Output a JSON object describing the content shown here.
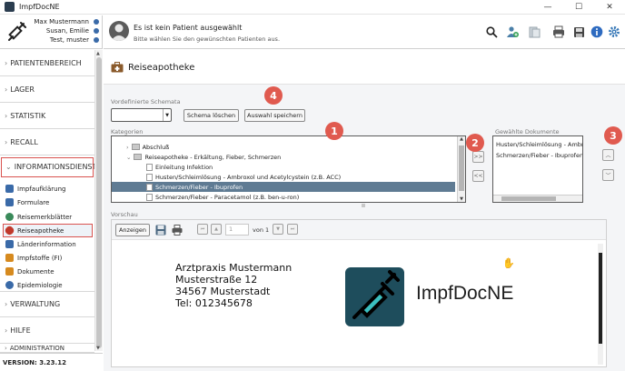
{
  "window": {
    "title": "ImpfDocNE",
    "minimize": "—",
    "maximize": "☐",
    "close": "✕"
  },
  "user": {
    "line1": "Max Mustermann",
    "line2": "Susan, Emilie",
    "line3": "Test, muster"
  },
  "patient": {
    "title": "Es ist kein Patient ausgewählt",
    "subtitle": "Bitte wählen Sie den gewünschten Patienten aus."
  },
  "toolbar_icons": [
    "search-icon",
    "add-patient-icon",
    "clipboard-icon",
    "print-icon",
    "disk-icon",
    "info-icon",
    "settings-icon"
  ],
  "sidebar": {
    "sections": [
      {
        "label": "PATIENTENBEREICH",
        "chevron": "›"
      },
      {
        "label": "LAGER",
        "chevron": "›"
      },
      {
        "label": "STATISTIK",
        "chevron": "›"
      },
      {
        "label": "RECALL",
        "chevron": "›"
      },
      {
        "label": "INFORMATIONSDIENST",
        "chevron": "⌄"
      }
    ],
    "items": [
      {
        "label": "Impfaufklärung",
        "color": "#3a6aa8"
      },
      {
        "label": "Formulare",
        "color": "#3a6aa8"
      },
      {
        "label": "Reisemerkblätter",
        "color": "#3a8a5a"
      },
      {
        "label": "Reiseapotheke",
        "color": "#c0392b"
      },
      {
        "label": "Länderinformation",
        "color": "#3a6aa8"
      },
      {
        "label": "Impfstoffe (FI)",
        "color": "#d68a1f"
      },
      {
        "label": "Dokumente",
        "color": "#d68a1f"
      },
      {
        "label": "Epidemiologie",
        "color": "#3a6aa8"
      }
    ],
    "bottom_sections": [
      {
        "label": "VERWALTUNG",
        "chevron": "›"
      },
      {
        "label": "HILFE",
        "chevron": "›"
      },
      {
        "label": "ADMINISTRATION",
        "chevron": "›"
      }
    ],
    "version": "VERSION: 3.23.12"
  },
  "page": {
    "title": "Reiseapotheke"
  },
  "schema": {
    "label": "Vordefinierte Schemata",
    "value": "",
    "delete_button": "Schema löschen",
    "save_button": "Auswahl speichern"
  },
  "categories": {
    "label": "Kategorien",
    "rows": [
      {
        "text": "Abschluß",
        "kind": "folder",
        "indent": 1,
        "toggle": "›"
      },
      {
        "text": "Reiseapotheke - Erkältung, Fieber, Schmerzen",
        "kind": "folder",
        "indent": 1,
        "toggle": "⌄"
      },
      {
        "text": "Einleitung Infektion",
        "kind": "doc",
        "indent": 2
      },
      {
        "text": "Husten/Schleimlösung - Ambroxol und Acetylcystein (z.B. ACC)",
        "kind": "doc",
        "indent": 2
      },
      {
        "text": "Schmerzen/Fieber - Ibuprofen",
        "kind": "doc",
        "indent": 2,
        "selected": true
      },
      {
        "text": "Schmerzen/Fieber - Paracetamol (z.B. ben-u-ron)",
        "kind": "doc",
        "indent": 2
      }
    ]
  },
  "transfer": {
    "add": ">>",
    "remove": "<<"
  },
  "chosen": {
    "label": "Gewählte Dokumente",
    "items": [
      "Husten/Schleimlösung - Ambroxol",
      "Schmerzen/Fieber - Ibuprofen"
    ],
    "up": "︿",
    "down": "﹀"
  },
  "badges": [
    "1",
    "2",
    "3",
    "4"
  ],
  "preview": {
    "label": "Vorschau",
    "show_button": "Anzeigen",
    "page_number": "1",
    "page_of": "von 1",
    "address": [
      "Arztpraxis Mustermann",
      "Musterstraße 12",
      "34567 Musterstadt",
      "Tel: 012345678"
    ],
    "logo_text": "ImpfDocNE",
    "logo_color": "#1e4d5c"
  }
}
